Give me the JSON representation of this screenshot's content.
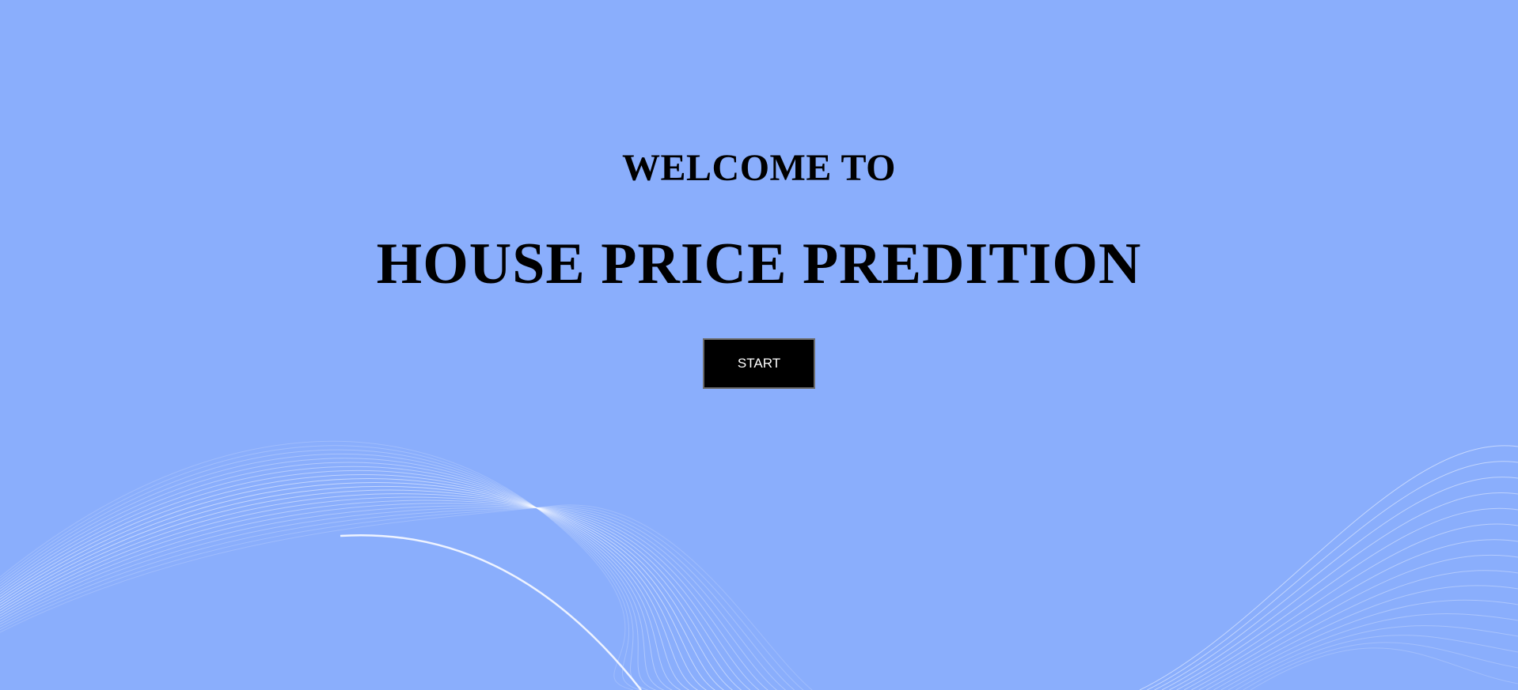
{
  "hero": {
    "welcome": "WELCOME TO",
    "title": "HOUSE PRICE PREDITION",
    "start_label": "START"
  },
  "colors": {
    "background": "#8aaefc",
    "text": "#000000",
    "button_bg": "#000000",
    "button_text": "#ffffff",
    "wave": "#ffffff"
  }
}
